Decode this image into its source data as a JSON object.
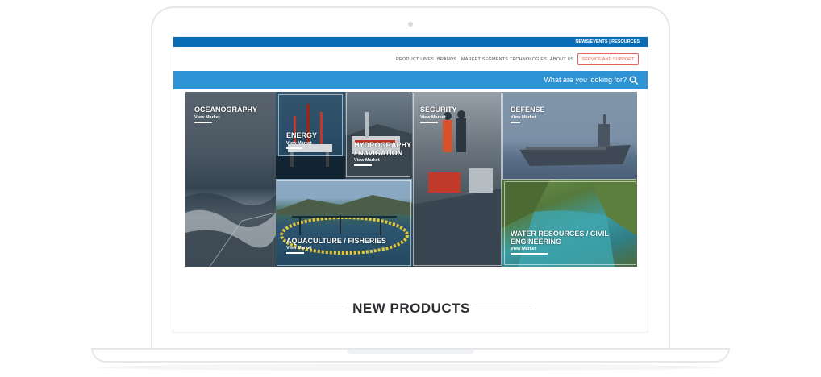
{
  "topbar": {
    "news_events": "NEWS/EVENTS",
    "separator": "|",
    "resources": "RESOURCES"
  },
  "nav": {
    "items": [
      "PRODUCT LINES",
      "BRANDS",
      "MARKET SEGMENTS",
      "TECHNOLOGIES",
      "ABOUT US"
    ],
    "cta": "SERVICE AND SUPPORT"
  },
  "search": {
    "prompt": "What are you looking for?",
    "icon": "search-icon"
  },
  "markets": [
    {
      "title": "OCEANOGRAPHY",
      "link": "View Market"
    },
    {
      "title": "ENERGY",
      "link": "View Market"
    },
    {
      "title": "HYDROGRAPHY / NAVIGATION",
      "link": "View Market"
    },
    {
      "title": "SECURITY",
      "link": "View Market"
    },
    {
      "title": "DEFENSE",
      "link": "View Market"
    },
    {
      "title": "AQUACULTURE / FISHERIES",
      "link": "View Market"
    },
    {
      "title": "WATER RESOURCES / CIVIL ENGINEERING",
      "link": "View Market"
    }
  ],
  "section": {
    "heading": "NEW PRODUCTS"
  },
  "colors": {
    "topbar": "#0a6eb6",
    "searchbar": "#2d93d4",
    "cta": "#e2665a"
  }
}
